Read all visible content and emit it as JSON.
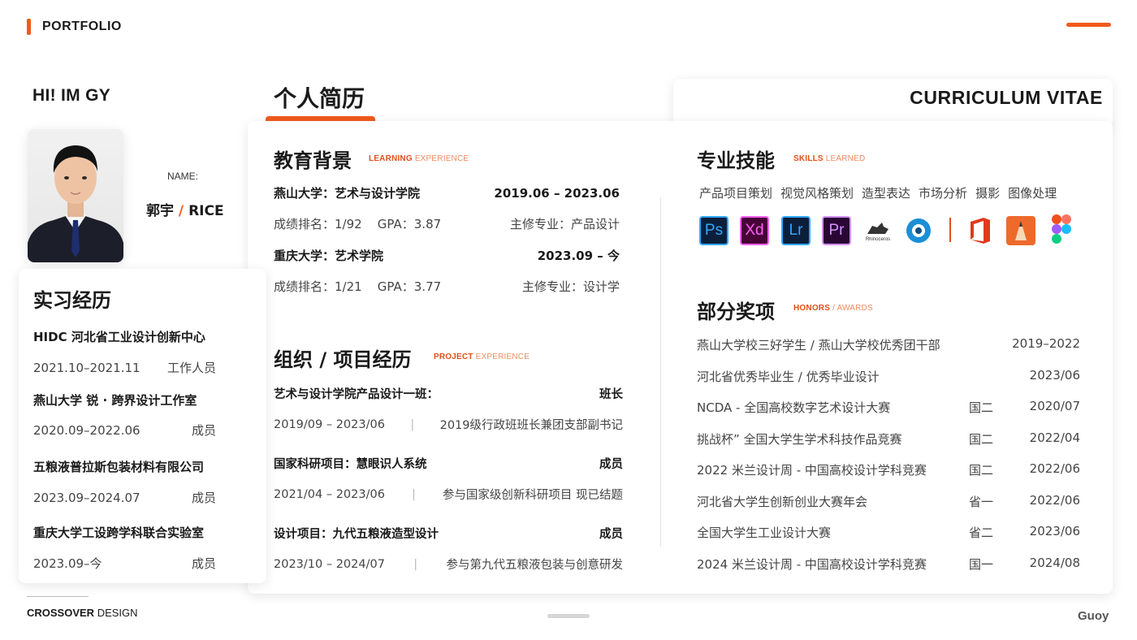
{
  "header": {
    "brand": "PORTFOLIO"
  },
  "intro": {
    "greeting": "HI! IM GY",
    "name_label": "NAME:",
    "name_cn": "郭宇",
    "name_sep": "/",
    "name_en": "RICE"
  },
  "resume": {
    "title": "个人简历",
    "vitae": "CURRICULUM VITAE"
  },
  "education": {
    "title": "教育背景",
    "tag_strong": "LEARNING",
    "tag_light": "EXPERIENCE",
    "items": [
      {
        "school": "燕山大学：艺术与设计学院",
        "period": "2019.06 – 2023.06",
        "rank_label": "成绩排名：",
        "rank": "1/92",
        "gpa_label": "GPA：",
        "gpa": "3.87",
        "major_label": "主修专业：",
        "major": "产品设计"
      },
      {
        "school": "重庆大学：艺术学院",
        "period": "2023.09 – 今",
        "rank_label": "成绩排名：",
        "rank": "1/21",
        "gpa_label": "GPA：",
        "gpa": "3.77",
        "major_label": "主修专业：",
        "major": "设计学"
      }
    ]
  },
  "projects": {
    "title": "组织 / 项目经历",
    "tag_strong": "PROJECT",
    "tag_light": "EXPERIENCE",
    "items": [
      {
        "name": "艺术与设计学院产品设计一班：",
        "role": "班长",
        "period": "2019/09 – 2023/06",
        "desc": "2019级行政班班长兼团支部副书记"
      },
      {
        "name": "国家科研项目：慧眼识人系统",
        "role": "成员",
        "period": "2021/04 – 2023/06",
        "desc": "参与国家级创新科研项目 现已结题"
      },
      {
        "name": "设计项目：九代五粮液造型设计",
        "role": "成员",
        "period": "2023/10 – 2024/07",
        "desc": "参与第九代五粮液包装与创意研发"
      }
    ]
  },
  "skills": {
    "title": "专业技能",
    "tag_strong": "SKILLS",
    "tag_light": "LEARNED",
    "list": [
      "产品项目策划",
      "视觉风格策划",
      "造型表达",
      "市场分析",
      "摄影",
      "图像处理"
    ],
    "software": [
      {
        "icon": "photoshop-icon",
        "label": "Ps",
        "bg": "#0b1f3b",
        "fg": "#31a8ff"
      },
      {
        "icon": "xd-icon",
        "label": "Xd",
        "bg": "#470137",
        "fg": "#ff61f6"
      },
      {
        "icon": "lightroom-icon",
        "label": "Lr",
        "bg": "#0b1f3b",
        "fg": "#31a8ff"
      },
      {
        "icon": "premiere-icon",
        "label": "Pr",
        "bg": "#2a0634",
        "fg": "#d291ff"
      },
      {
        "icon": "rhino-icon",
        "label": "Rhinoceros",
        "bg": "#ffffff",
        "fg": "#333333"
      },
      {
        "icon": "keyshot-icon",
        "label": "",
        "bg": "#ffffff",
        "fg": "#1a8fd6"
      },
      {
        "icon": "office-icon",
        "label": "",
        "bg": "#ffffff",
        "fg": "#e03a1e"
      },
      {
        "icon": "sketchbook-icon",
        "label": "",
        "bg": "#ee6a2b",
        "fg": "#ffffff"
      },
      {
        "icon": "figma-icon",
        "label": "",
        "bg": "#ffffff",
        "fg": "#f24e1e"
      }
    ]
  },
  "honors": {
    "title": "部分奖项",
    "tag_strong": "HONORS",
    "tag_light": "/ AWARDS",
    "items": [
      {
        "name": "燕山大学校三好学生 / 燕山大学校优秀团干部",
        "level": "",
        "date": "2019–2022"
      },
      {
        "name": "河北省优秀毕业生 / 优秀毕业设计",
        "level": "",
        "date": "2023/06"
      },
      {
        "name": "NCDA - 全国高校数字艺术设计大赛",
        "level": "国二",
        "date": "2020/07"
      },
      {
        "name": "挑战杯” 全国大学生学术科技作品竞赛",
        "level": "国二",
        "date": "2022/04"
      },
      {
        "name": "2022 米兰设计周 - 中国高校设计学科竞赛",
        "level": "国二",
        "date": "2022/06"
      },
      {
        "name": "河北省大学生创新创业大赛年会",
        "level": "省一",
        "date": "2022/06"
      },
      {
        "name": "全国大学生工业设计大赛",
        "level": "省二",
        "date": "2023/06"
      },
      {
        "name": "2024 米兰设计周 - 中国高校设计学科竞赛",
        "level": "国一",
        "date": "2024/08"
      }
    ]
  },
  "internship": {
    "title": "实习经历",
    "items": [
      {
        "org": "HIDC 河北省工业设计创新中心",
        "period": "2021.10–2021.11",
        "role": "工作人员"
      },
      {
        "org": "燕山大学 锐 · 跨界设计工作室",
        "period": "2020.09–2022.06",
        "role": "成员"
      },
      {
        "org": "五粮液普拉斯包装材料有限公司",
        "period": "2023.09–2024.07",
        "role": "成员"
      },
      {
        "org": "重庆大学工设跨学科联合实验室",
        "period": "2023.09–今",
        "role": "成员"
      }
    ]
  },
  "footer": {
    "brand_bold": "CROSSOVER",
    "brand_light": "DESIGN",
    "signature": "Guoy"
  }
}
